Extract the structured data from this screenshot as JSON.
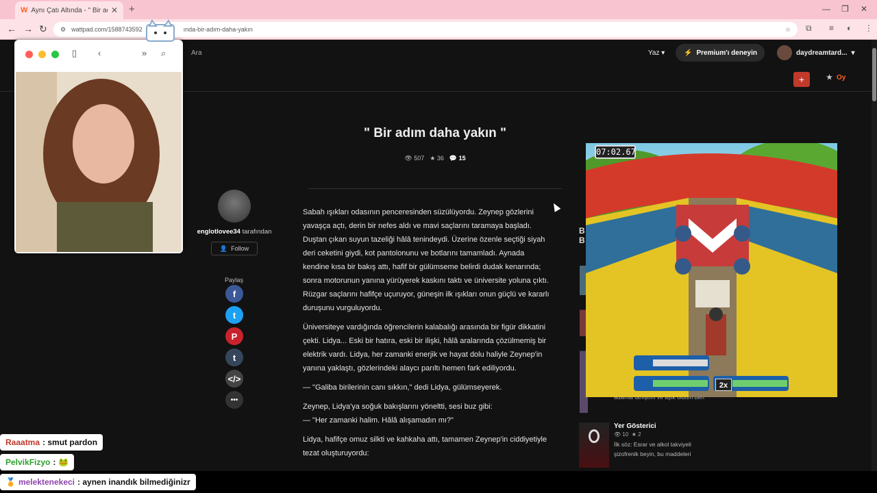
{
  "browser": {
    "tab_title": "Aynı Çatı Altında - \" Bir adım da",
    "url_prefix": "wattpad.com/1588743592",
    "url_suffix": "ında-bir-adım-daha-yakın"
  },
  "header": {
    "search_label": "Ara",
    "write_label": "Yaz",
    "premium_label": "Premium'ı deneyin",
    "username": "daydreamtard...",
    "vote_label": "Oy"
  },
  "story": {
    "title": "\" Bir adım daha yakın \"",
    "reads": "507",
    "votes": "36",
    "comments": "15",
    "author": "englotlovee34",
    "author_suffix": " tarafından",
    "follow_label": "Follow",
    "share_label": "Paylaş",
    "paragraphs": [
      "Sabah ışıkları odasının penceresinden süzülüyordu. Zeynep gözlerini yavaşça açtı, derin bir nefes aldı ve mavi saçlarını taramaya başladı. Duştan çıkan suyun tazeliği hâlâ tenindeydi. Üzerine özenle seçtiği siyah deri ceketini giydi, kot pantolonunu ve botlarını tamamladı. Aynada kendine kısa bir bakış attı, hafif bir gülümseme belirdi dudak kenarında; sonra motorunun yanına yürüyerek kaskını taktı ve üniversite yoluna çıktı. Rüzgar saçlarını hafifçe uçuruyor, güneşin ilk ışıkları onun güçlü ve kararlı duruşunu vurguluyordu.",
      "Üniversiteye vardığında öğrencilerin kalabalığı arasında bir figür dikkatini çekti. Lidya... Eski bir hatıra, eski bir ilişki, hâlâ aralarında çözülmemiş bir elektrik vardı. Lidya, her zamanki enerjik ve hayat dolu haliyle Zeynep'in yanına yaklaştı, gözlerindeki alaycı parıltı hemen fark ediliyordu.",
      "— \"Galiba birilerinin canı sıkkın,\" dedi Lidya, gülümseyerek.",
      "Zeynep, Lidya'ya soğuk bakışlarını yöneltti, sesi buz gibi:",
      "— \"Her zamanki halim. Hâlâ alışamadın mı?\"",
      "Lidya, hafifçe omuz silkti ve kahkaha attı, tamamen Zeynep'in ciddiyetiyle tezat oluşturuyordu:"
    ]
  },
  "sidebar": {
    "partial_text": "adamla tanıştım ve aşık oldum ben",
    "related": {
      "title": "Yer Gösterici",
      "reads": "10",
      "votes": "2",
      "desc": "İlk söz: Esrar ve alkol takviyeli şizofrenik beyin, bu maddeleri"
    }
  },
  "game": {
    "timer": "07:02.67",
    "multiplier": "2x"
  },
  "chat": [
    {
      "user": "Raaatma",
      "message": ": smut pardon",
      "color": "#c0392b"
    },
    {
      "user": "PelvikFizyo",
      "message": ":",
      "color": "#2e9e2e"
    },
    {
      "user": "melektenekeci",
      "message": ": aynen inandık bilmediğinizr",
      "color": "#8e44ad"
    }
  ]
}
